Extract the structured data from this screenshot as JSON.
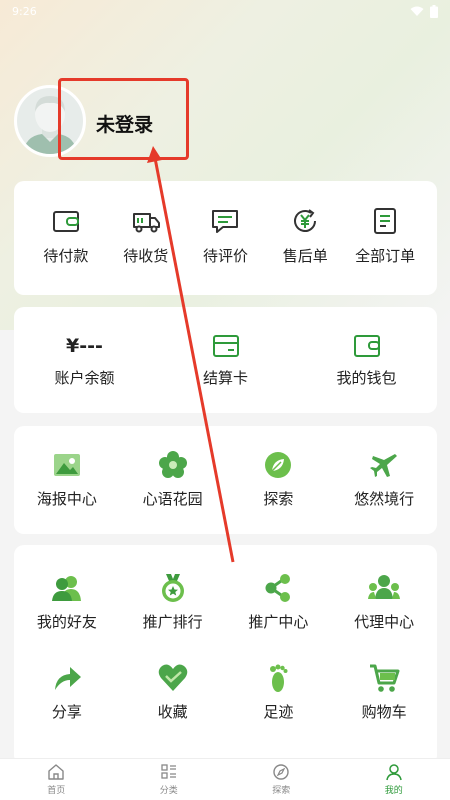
{
  "status_bar": {
    "time": "9:26"
  },
  "profile": {
    "username": "未登录"
  },
  "orders": [
    {
      "label": "待付款",
      "icon": "wallet-card-icon"
    },
    {
      "label": "待收货",
      "icon": "truck-icon"
    },
    {
      "label": "待评价",
      "icon": "comment-icon"
    },
    {
      "label": "售后单",
      "icon": "yen-refresh-icon"
    },
    {
      "label": "全部订单",
      "icon": "order-list-icon"
    }
  ],
  "wallet": {
    "balance_value": "¥---",
    "balance_label": "账户余额",
    "settle_card_label": "结算卡",
    "my_wallet_label": "我的钱包"
  },
  "apps": [
    {
      "label": "海报中心",
      "icon": "poster-icon"
    },
    {
      "label": "心语花园",
      "icon": "flower-icon"
    },
    {
      "label": "探索",
      "icon": "leaf-compass-icon"
    },
    {
      "label": "悠然境行",
      "icon": "airplane-icon"
    }
  ],
  "services": [
    {
      "label": "我的好友",
      "icon": "friends-icon"
    },
    {
      "label": "推广排行",
      "icon": "medal-icon"
    },
    {
      "label": "推广中心",
      "icon": "share-nodes-icon"
    },
    {
      "label": "代理中心",
      "icon": "agent-group-icon"
    },
    {
      "label": "分享",
      "icon": "share-arrow-icon"
    },
    {
      "label": "收藏",
      "icon": "heart-icon"
    },
    {
      "label": "足迹",
      "icon": "footprint-icon"
    },
    {
      "label": "购物车",
      "icon": "cart-icon"
    }
  ],
  "tabbar": [
    {
      "label": "首页",
      "icon": "home-icon"
    },
    {
      "label": "分类",
      "icon": "category-icon"
    },
    {
      "label": "探索",
      "icon": "compass-icon"
    },
    {
      "label": "我的",
      "icon": "user-icon",
      "active": true
    }
  ],
  "colors": {
    "accent_green": "#2e9a3a",
    "annotation_red": "#e53a2a"
  }
}
